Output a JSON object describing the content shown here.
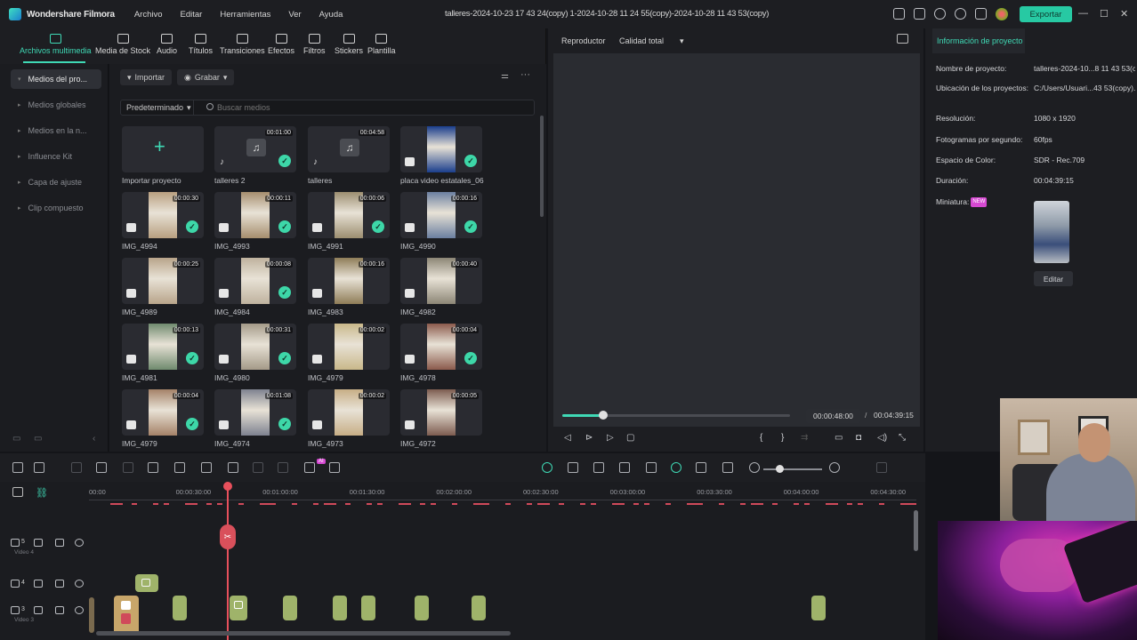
{
  "app": {
    "name": "Wondershare Filmora",
    "window_title": "talleres-2024-10-23 17 43 24(copy) 1-2024-10-28 11 24 55(copy)-2024-10-28 11 43 53(copy)",
    "export_label": "Exportar"
  },
  "menu": [
    "Archivo",
    "Editar",
    "Herramientas",
    "Ver",
    "Ayuda"
  ],
  "toolbar": {
    "tabs": [
      {
        "label": "Archivos multimedia",
        "icon": "folder-icon",
        "active": true
      },
      {
        "label": "Media de Stock",
        "icon": "stock-icon"
      },
      {
        "label": "Audio",
        "icon": "music-icon"
      },
      {
        "label": "Títulos",
        "icon": "title-icon"
      },
      {
        "label": "Transiciones",
        "icon": "transition-icon"
      },
      {
        "label": "Efectos",
        "icon": "effects-icon"
      },
      {
        "label": "Filtros",
        "icon": "filters-icon"
      },
      {
        "label": "Stickers",
        "icon": "sticker-icon"
      },
      {
        "label": "Plantilla",
        "icon": "template-icon"
      }
    ]
  },
  "sidebar": {
    "items": [
      {
        "label": "Medios del pro...",
        "active": true
      },
      {
        "label": "Medios globales"
      },
      {
        "label": "Medios en la n..."
      },
      {
        "label": "Influence Kit"
      },
      {
        "label": "Capa de ajuste"
      },
      {
        "label": "Clip compuesto"
      }
    ]
  },
  "media": {
    "import_label": "Importar",
    "record_label": "Grabar",
    "preset_label": "Predeterminado",
    "search_placeholder": "Buscar medios",
    "import_project_label": "Importar proyecto",
    "items": [
      {
        "name": "talleres 2",
        "duration": "00:01:00",
        "type": "audio",
        "check": true
      },
      {
        "name": "talleres",
        "duration": "00:04:58",
        "type": "audio",
        "check": false
      },
      {
        "name": "placa video estatales_06",
        "duration": "",
        "type": "image",
        "check": true,
        "color": "#1a3e8c"
      },
      {
        "name": "IMG_4994",
        "duration": "00:00:30",
        "type": "video",
        "check": true,
        "color": "#b89f80"
      },
      {
        "name": "IMG_4993",
        "duration": "00:00:11",
        "type": "video",
        "check": true,
        "color": "#a68e6e"
      },
      {
        "name": "IMG_4991",
        "duration": "00:00:06",
        "type": "video",
        "check": true,
        "color": "#9c8e70"
      },
      {
        "name": "IMG_4990",
        "duration": "00:00:16",
        "type": "video",
        "check": true,
        "color": "#6b7fa0"
      },
      {
        "name": "IMG_4989",
        "duration": "00:00:25",
        "type": "video",
        "check": false,
        "color": "#b8a48a"
      },
      {
        "name": "IMG_4984",
        "duration": "00:00:08",
        "type": "video",
        "check": true,
        "color": "#bfb29e"
      },
      {
        "name": "IMG_4983",
        "duration": "00:00:16",
        "type": "video",
        "check": false,
        "color": "#8f7d58"
      },
      {
        "name": "IMG_4982",
        "duration": "00:00:40",
        "type": "video",
        "check": false,
        "color": "#8c8676"
      },
      {
        "name": "IMG_4981",
        "duration": "00:00:13",
        "type": "video",
        "check": true,
        "color": "#6f8a6e"
      },
      {
        "name": "IMG_4980",
        "duration": "00:00:31",
        "type": "video",
        "check": true,
        "color": "#a49a88"
      },
      {
        "name": "IMG_4979",
        "duration": "00:00:02",
        "type": "video",
        "check": false,
        "color": "#c9b88a"
      },
      {
        "name": "IMG_4978",
        "duration": "00:00:04",
        "type": "video",
        "check": true,
        "color": "#8b5a4c"
      },
      {
        "name": "IMG_4979",
        "duration": "00:00:04",
        "type": "video",
        "check": true,
        "color": "#a58268"
      },
      {
        "name": "IMG_4974",
        "duration": "00:01:08",
        "type": "video",
        "check": true,
        "color": "#7e8290"
      },
      {
        "name": "IMG_4973",
        "duration": "00:00:02",
        "type": "video",
        "check": false,
        "color": "#c7ae86"
      },
      {
        "name": "IMG_4972",
        "duration": "00:00:05",
        "type": "video",
        "check": false,
        "color": "#7d5c50"
      }
    ]
  },
  "player": {
    "tab_label": "Reproductor",
    "quality_label": "Calidad total",
    "current_time": "00:00:48:00",
    "separator": "/",
    "total_time": "00:04:39:15",
    "progress": 0.18
  },
  "info": {
    "tab_label": "Información de proyecto",
    "fields": [
      {
        "key": "Nombre de proyecto:",
        "value": "talleres-2024-10...8 11 43 53(copy)"
      },
      {
        "key": "Ubicación de los proyectos:",
        "value": "C:/Users/Usuari...43 53(copy).wfp"
      },
      {
        "key": "Resolución:",
        "value": "1080 x 1920"
      },
      {
        "key": "Fotogramas por segundo:",
        "value": "60fps"
      },
      {
        "key": "Espacio de Color:",
        "value": "SDR - Rec.709"
      },
      {
        "key": "Duración:",
        "value": "00:04:39:15"
      }
    ],
    "thumbnail_label": "Miniatura:",
    "new_badge": "NEW",
    "edit_label": "Editar"
  },
  "timeline": {
    "ruler": [
      "00:00",
      "00:00:30:00",
      "00:01:00:00",
      "00:01:30:00",
      "00:02:00:00",
      "00:02:30:00",
      "00:03:00:00",
      "00:03:30:00",
      "00:04:00:00",
      "00:04:30:00"
    ],
    "tracks": [
      {
        "number": "5",
        "name": "Video 4"
      },
      {
        "number": "4",
        "name": ""
      },
      {
        "number": "3",
        "name": "Video 3"
      }
    ],
    "ai_badge": "AI"
  },
  "colors": {
    "accent": "#3fd9b5",
    "playhead": "#e8505c",
    "clip": "#9fb36a",
    "new_badge": "#d649d2"
  }
}
